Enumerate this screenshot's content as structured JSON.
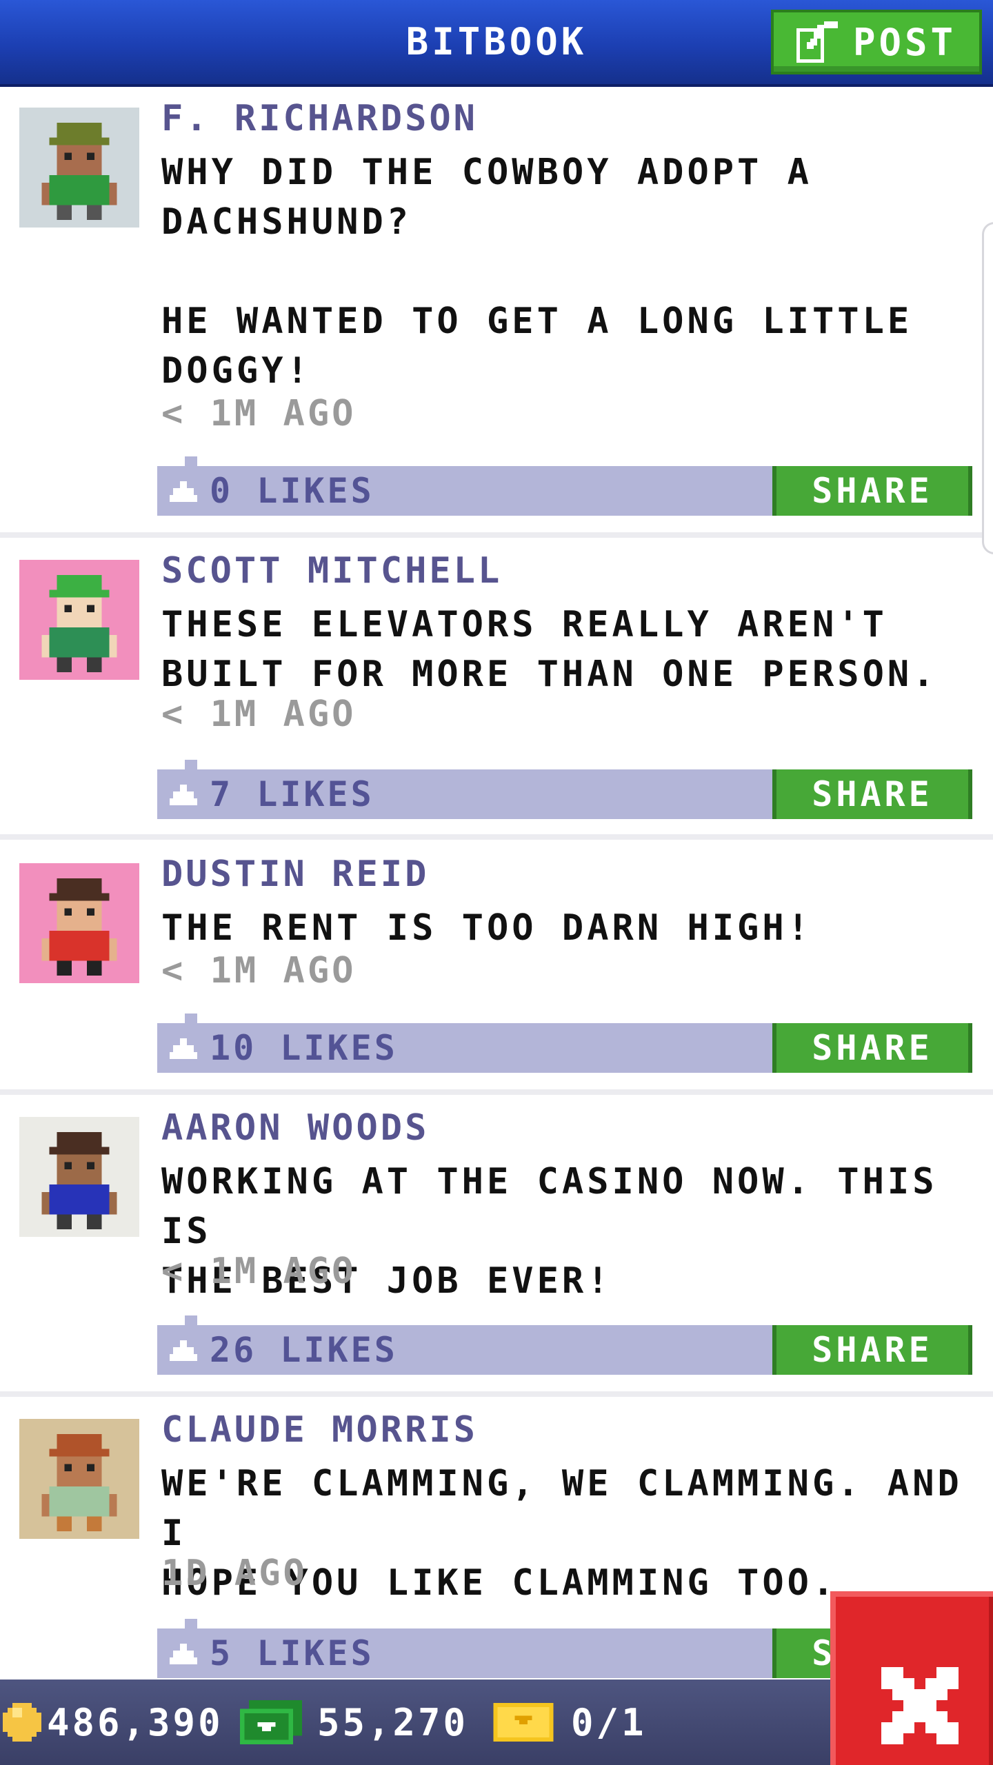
{
  "header": {
    "title": "BITBOOK",
    "post_label": "POST"
  },
  "posts": [
    {
      "author": "F. RICHARDSON",
      "message": "WHY DID THE COWBOY ADOPT A\nDACHSHUND?\n\nHE WANTED TO GET A LONG LITTLE\nDOGGY!",
      "time": "< 1M AGO",
      "likes": "0 LIKES",
      "share": "SHARE",
      "avatar": {
        "bg": "#cfd8dc",
        "skin": "#a86d4e",
        "hat": "#6d7d2c",
        "shirt": "#2f9a3f",
        "pants": "#555555"
      }
    },
    {
      "author": "SCOTT MITCHELL",
      "message": "THESE ELEVATORS REALLY AREN'T\nBUILT FOR MORE THAN ONE PERSON.",
      "time": "< 1M AGO",
      "likes": "7 LIKES",
      "share": "SHARE",
      "avatar": {
        "bg": "#f28fbd",
        "skin": "#f1d6b8",
        "hat": "#3cb043",
        "shirt": "#2d8f55",
        "pants": "#3a3a3a"
      }
    },
    {
      "author": "DUSTIN REID",
      "message": "THE RENT IS TOO DARN HIGH!",
      "time": "< 1M AGO",
      "likes": "10 LIKES",
      "share": "SHARE",
      "avatar": {
        "bg": "#f28fbd",
        "skin": "#e5b18c",
        "hat": "#4a2e22",
        "shirt": "#d9332b",
        "pants": "#222222"
      }
    },
    {
      "author": "AARON WOODS",
      "message": "WORKING AT THE CASINO NOW. THIS IS\nTHE BEST JOB EVER!",
      "time": "< 1M AGO",
      "likes": "26 LIKES",
      "share": "SHARE",
      "avatar": {
        "bg": "#ebebe6",
        "skin": "#9c6a48",
        "hat": "#4a2e22",
        "shirt": "#2733b8",
        "pants": "#3a3a3a"
      }
    },
    {
      "author": "CLAUDE MORRIS",
      "message": "WE'RE CLAMMING, WE CLAMMING. AND I\nHOPE YOU LIKE CLAMMING TOO.",
      "time": "1D AGO",
      "likes": "5 LIKES",
      "share": "SHARE",
      "avatar": {
        "bg": "#d6c29a",
        "skin": "#b97a52",
        "hat": "#b0532a",
        "shirt": "#9fc6a0",
        "pants": "#c47a3a"
      }
    }
  ],
  "status": {
    "coins": "486,390",
    "cash": "55,270",
    "tickets": "0/1"
  },
  "colors": {
    "header_blue": "#1c3fb2",
    "share_green": "#47a837",
    "likes_bar": "#b3b5d8",
    "close_red": "#e0262a"
  }
}
